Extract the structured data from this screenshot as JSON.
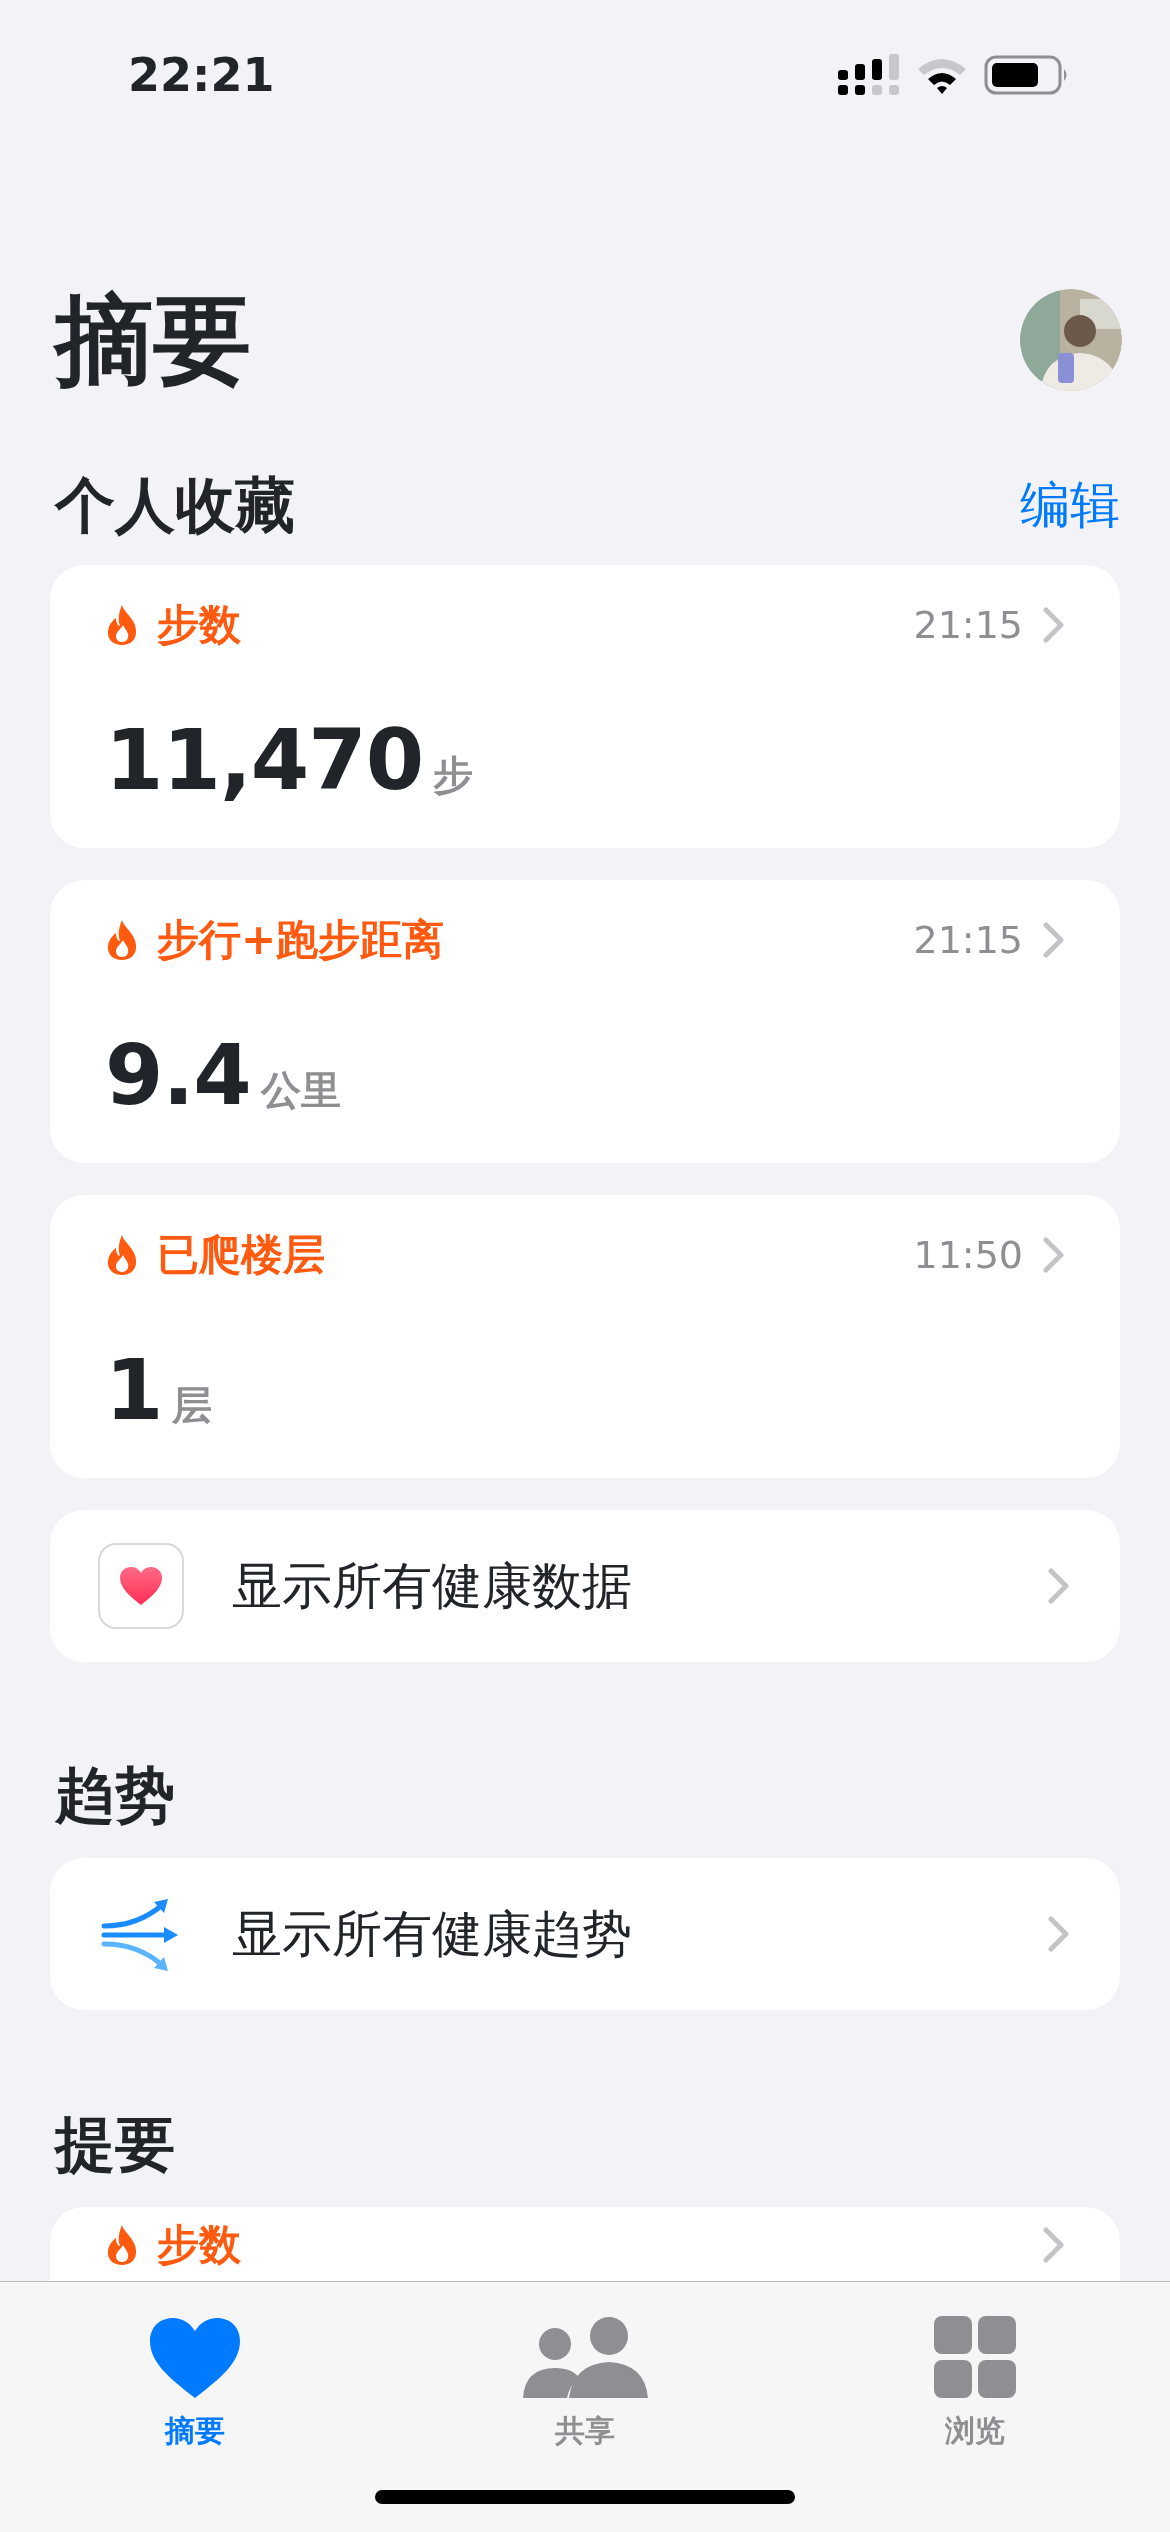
{
  "status_bar": {
    "time": "22:21"
  },
  "title": "摘要",
  "favorites": {
    "heading": "个人收藏",
    "edit": "编辑",
    "cards": [
      {
        "title": "步数",
        "time": "21:15",
        "value": "11,470",
        "unit": "步"
      },
      {
        "title": "步行+跑步距离",
        "time": "21:15",
        "value": "9.4",
        "unit": "公里"
      },
      {
        "title": "已爬楼层",
        "time": "11:50",
        "value": "1",
        "unit": "层"
      }
    ]
  },
  "show_all_data": {
    "label": "显示所有健康数据"
  },
  "trends": {
    "heading": "趋势",
    "label": "显示所有健康趋势"
  },
  "highlights": {
    "heading": "提要",
    "cards": [
      {
        "title": "步数"
      }
    ]
  },
  "tabs": [
    {
      "label": "摘要",
      "kind": "heart",
      "selected": true
    },
    {
      "label": "共享",
      "kind": "people",
      "selected": false
    },
    {
      "label": "浏览",
      "kind": "grid",
      "selected": false
    }
  ]
}
